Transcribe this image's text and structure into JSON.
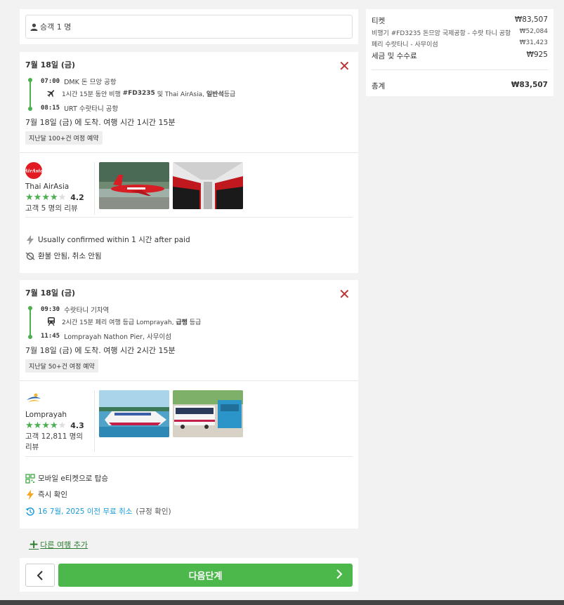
{
  "passenger": {
    "label": "승객 1 명"
  },
  "segments": [
    {
      "date": "7월 18일 (금)",
      "depart_time": "07:00",
      "depart_place": "DMK 돈 므앙 공항",
      "detail_prefix": "1시간 15분 동안 비행",
      "detail_code": "#FD3235",
      "detail_mid": "및 Thai AirAsia,",
      "detail_class": "일반석",
      "detail_suffix": "등급",
      "arrive_time": "08:15",
      "arrive_place": "URT 수랏타니 공항",
      "arrival_summary": "7월 18일 (금) 에 도착. 여행 시간 1시간 15분",
      "badge": "지난달 100+건 여정 예약",
      "carrier": "Thai AirAsia",
      "rating": "4.2",
      "reviews": "고객 5 명의 리뷰",
      "features": [
        {
          "icon": "lightning-icon",
          "text": "Usually confirmed within 1 시간 after paid"
        },
        {
          "icon": "no-refund-icon",
          "text": "환불 안됨, 취소 안됨"
        }
      ]
    },
    {
      "date": "7월 18일 (금)",
      "depart_time": "09:30",
      "depart_place": "수랏타니 기차역",
      "detail_prefix": "2시간 15분 페리 여행 등급 Lomprayah,",
      "detail_class": "급행",
      "detail_suffix": "등급",
      "arrive_time": "11:45",
      "arrive_place": "Lomprayah Nathon Pier, 사무이섬",
      "arrival_summary": "7월 18일 (금) 에 도착. 여행 시간 2시간 15분",
      "badge": "지난달 50+건 여정 예약",
      "carrier": "Lomprayah",
      "rating": "4.3",
      "reviews": "고객 12,811 명의 리뷰",
      "features": [
        {
          "icon": "qr-code-icon",
          "text": "모바일 e티켓으로 탑승"
        },
        {
          "icon": "lightning-icon",
          "text": "즉시 확인"
        },
        {
          "icon": "free-cancel-icon",
          "text": "16 7월, 2025 이전 무료 취소",
          "extra": "(규정 확인)"
        }
      ]
    }
  ],
  "add_trip": "다른 여행 추가",
  "next_label": "다음단계",
  "summary": {
    "ticket_label": "티켓",
    "ticket_value": "₩83,507",
    "line1_label": "비행기 #FD3235 돈므앙 국제공항 - 수랏 타니 공항",
    "line1_value": "₩52,084",
    "line2_label": "페리 수랏타니 - 사무이섬",
    "line2_value": "₩31,423",
    "tax_label": "세금 및 수수료",
    "tax_value": "₩925",
    "total_label": "총계",
    "total_value": "₩83,507"
  },
  "colors": {
    "accent_green": "#4cb84c",
    "close_red": "#b33333",
    "link_blue": "#1a9bd7"
  }
}
